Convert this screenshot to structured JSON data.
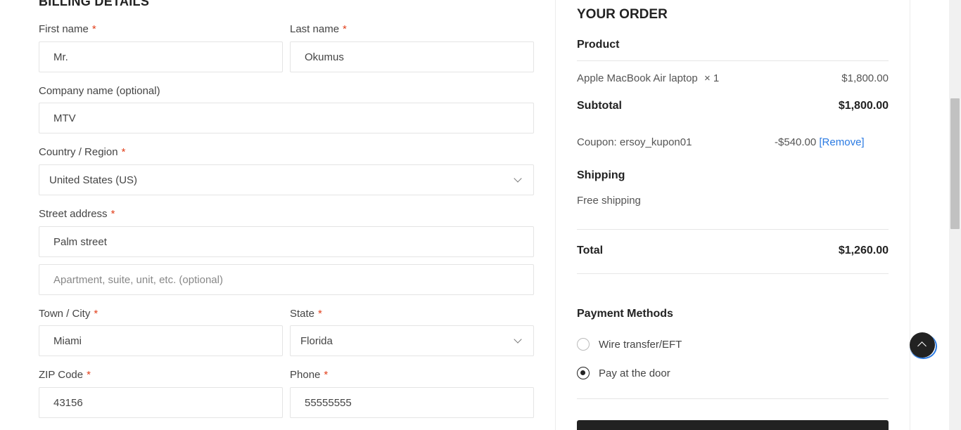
{
  "billing": {
    "title": "BILLING DETAILS",
    "first_name": {
      "label": "First name",
      "value": "Mr."
    },
    "last_name": {
      "label": "Last name",
      "value": "Okumus"
    },
    "company": {
      "label": "Company name (optional)",
      "value": "MTV"
    },
    "country": {
      "label": "Country / Region",
      "value": "United States (US)"
    },
    "street": {
      "label": "Street address",
      "value": "Palm street",
      "placeholder2": "Apartment, suite, unit, etc. (optional)"
    },
    "city": {
      "label": "Town / City",
      "value": "Miami"
    },
    "state": {
      "label": "State",
      "value": "Florida"
    },
    "zip": {
      "label": "ZIP Code",
      "value": "43156"
    },
    "phone": {
      "label": "Phone",
      "value": "55555555"
    },
    "required_mark": "*"
  },
  "order": {
    "title": "YOUR ORDER",
    "product_header": "Product",
    "item_name": "Apple MacBook Air laptop",
    "item_qty": "× 1",
    "item_price": "$1,800.00",
    "subtotal_label": "Subtotal",
    "subtotal_value": "$1,800.00",
    "coupon_label": "Coupon: ersoy_kupon01",
    "coupon_value": "-$540.00",
    "coupon_remove": "[Remove]",
    "shipping_label": "Shipping",
    "shipping_value": "Free shipping",
    "total_label": "Total",
    "total_value": "$1,260.00"
  },
  "payment": {
    "title": "Payment Methods",
    "methods": [
      {
        "label": "Wire transfer/EFT",
        "checked": false
      },
      {
        "label": "Pay at the door",
        "checked": true
      }
    ]
  },
  "icons": {
    "back_to_top": "chevron-up-icon",
    "select_arrow": "chevron-down-icon"
  },
  "colors": {
    "required": "#e2401c",
    "link": "#2a7ae2",
    "dark": "#222222"
  }
}
